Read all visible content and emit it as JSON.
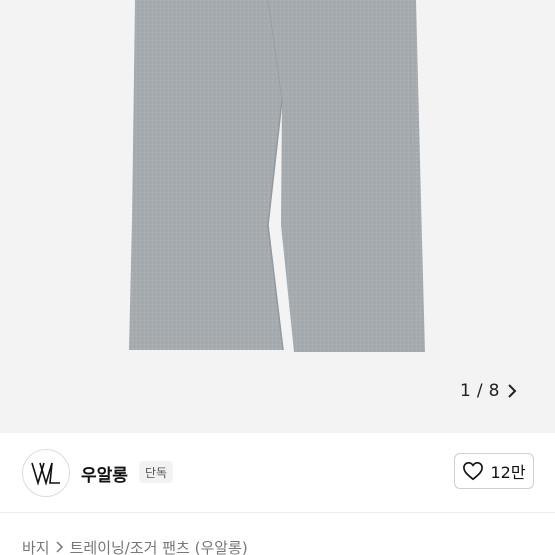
{
  "gallery": {
    "image": "gray wide-leg training pants",
    "current_page": "1",
    "separator": "/",
    "total_pages": "8"
  },
  "brand": {
    "logo_icon": "brand-logo-icon",
    "name": "우알롱",
    "badge": "단독"
  },
  "like": {
    "icon": "heart-outline-icon",
    "count": "12만"
  },
  "breadcrumb": {
    "root": "바지",
    "category": "트레이닝/조거 팬츠 (우알롱)"
  },
  "colors": {
    "gallery_bg": "#f3f3f3",
    "pants_gray": "#a7acb0"
  }
}
